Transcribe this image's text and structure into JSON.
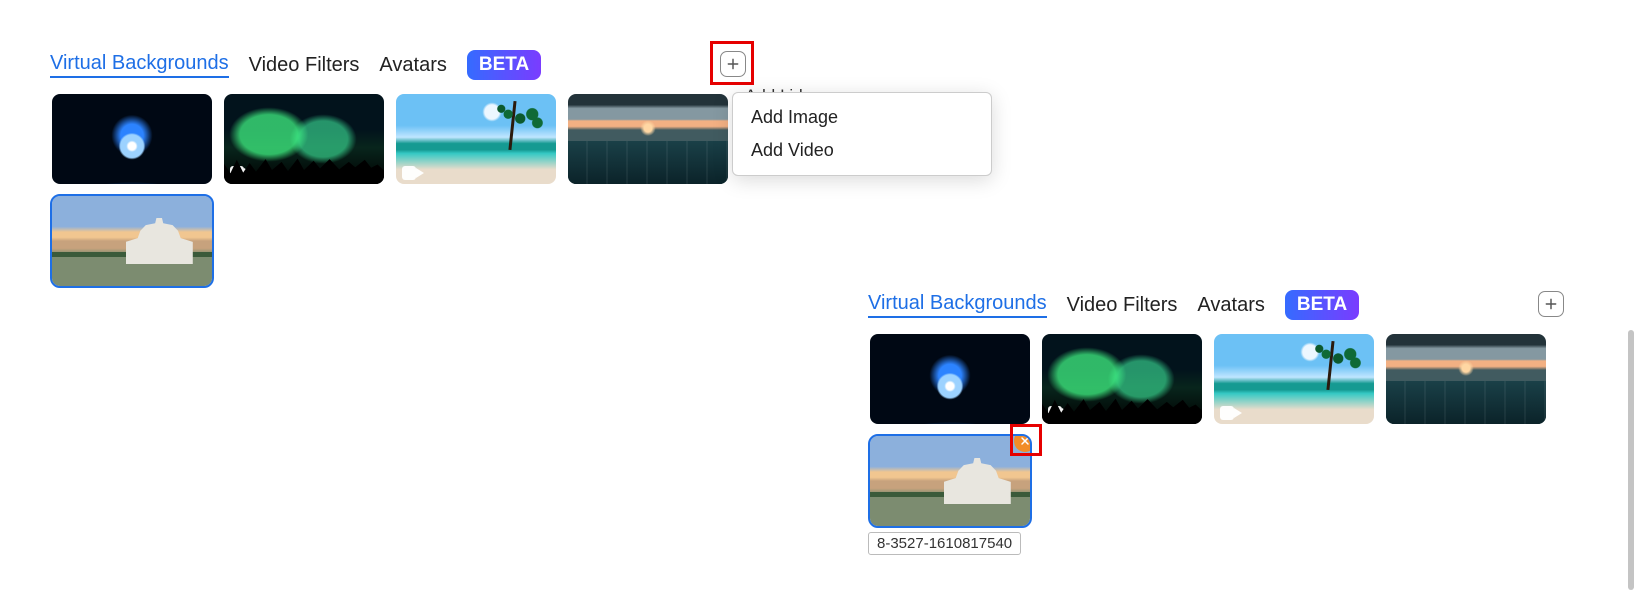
{
  "left": {
    "tabs": {
      "virtual_backgrounds": "Virtual Backgrounds",
      "video_filters": "Video Filters",
      "avatars": "Avatars",
      "beta": "BETA"
    },
    "menu_peek": "Add I                    id",
    "dropdown": {
      "add_image": "Add Image",
      "add_video": "Add Video"
    }
  },
  "right": {
    "tabs": {
      "virtual_backgrounds": "Virtual Backgrounds",
      "video_filters": "Video Filters",
      "avatars": "Avatars",
      "beta": "BETA"
    },
    "tooltip": "8-3527-1610817540"
  },
  "thumbs": {
    "earth": "earth-space",
    "aurora": "aurora-borealis",
    "beach": "tropical-beach",
    "sea": "ocean-sunset",
    "capitol": "us-capitol"
  }
}
